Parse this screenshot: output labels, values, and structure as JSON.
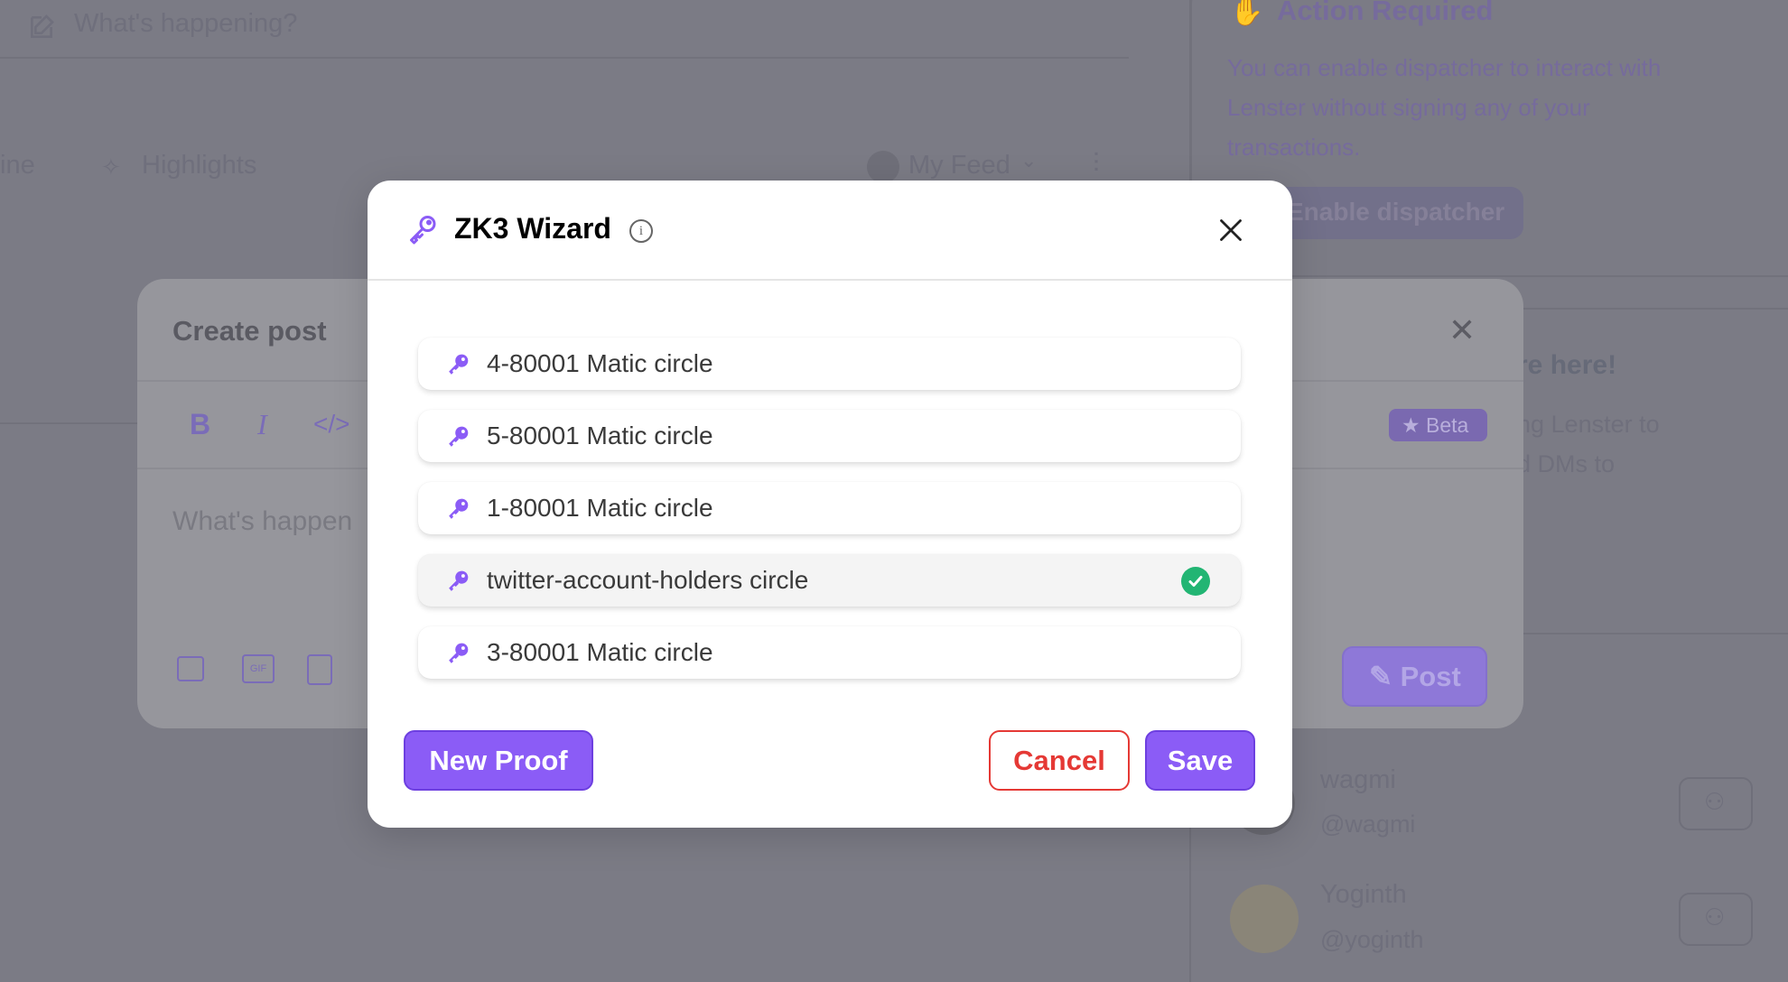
{
  "background": {
    "composer_placeholder": "What's happening?",
    "tabs": [
      {
        "label": "ine"
      },
      {
        "label": "Highlights"
      }
    ],
    "feed_selector": "My Feed",
    "action_card": {
      "title": "Action Required",
      "lines": [
        "You can enable dispatcher to interact with",
        "Lenster without signing any of your",
        "transactions."
      ],
      "button": "Enable dispatcher"
    },
    "info_card": {
      "title": "re here!",
      "lines": [
        "ng Lenster to",
        "d DMs to"
      ]
    },
    "suggestions": [
      {
        "name": "wagmi",
        "handle": "@wagmi"
      },
      {
        "name": "Yoginth",
        "handle": "@yoginth"
      }
    ],
    "create_post": {
      "title": "Create post",
      "toolbar": {
        "bold": "B",
        "italic": "I",
        "code": "</>"
      },
      "beta_badge": "Beta",
      "placeholder": "What's happen",
      "post_button": "Post"
    }
  },
  "modal": {
    "title": "ZK3 Wizard",
    "accent": "#8b5cf6",
    "items": [
      {
        "label": "4-80001 Matic circle",
        "selected": false
      },
      {
        "label": "5-80001 Matic circle",
        "selected": false
      },
      {
        "label": "1-80001 Matic circle",
        "selected": false
      },
      {
        "label": "twitter-account-holders circle",
        "selected": true
      },
      {
        "label": "3-80001 Matic circle",
        "selected": false
      }
    ],
    "new_proof": "New Proof",
    "cancel": "Cancel",
    "save": "Save"
  }
}
